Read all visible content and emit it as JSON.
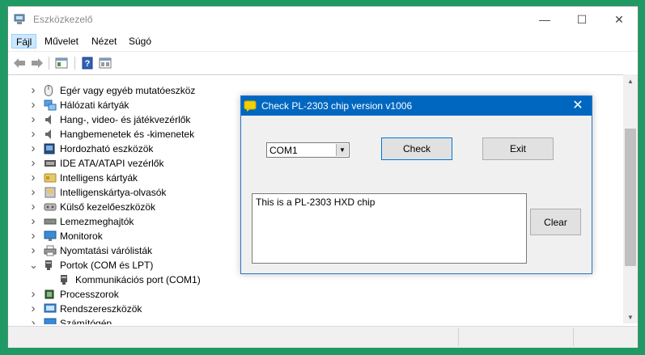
{
  "window": {
    "title": "Eszközkezelő",
    "controls": {
      "minimize": "—",
      "maximize": "☐",
      "close": "✕"
    }
  },
  "menu": {
    "items": [
      "Fájl",
      "Művelet",
      "Nézet",
      "Súgó"
    ]
  },
  "toolbar": {
    "icons": [
      "back-arrow-icon",
      "forward-arrow-icon",
      "properties-icon",
      "help-icon",
      "show-hidden-icon"
    ]
  },
  "tree": {
    "items": [
      {
        "label": "Egér vagy egyéb mutatóeszköz",
        "icon": "mouse-icon",
        "expanded": false,
        "level": 0
      },
      {
        "label": "Hálózati kártyák",
        "icon": "network-icon",
        "expanded": false,
        "level": 0
      },
      {
        "label": "Hang-, video- és játékvezérlők",
        "icon": "speaker-icon",
        "expanded": false,
        "level": 0
      },
      {
        "label": "Hangbemenetek és -kimenetek",
        "icon": "speaker-icon",
        "expanded": false,
        "level": 0
      },
      {
        "label": "Hordozható eszközök",
        "icon": "portable-device-icon",
        "expanded": false,
        "level": 0
      },
      {
        "label": "IDE ATA/ATAPI vezérlők",
        "icon": "ide-controller-icon",
        "expanded": false,
        "level": 0
      },
      {
        "label": "Intelligens kártyák",
        "icon": "smart-card-icon",
        "expanded": false,
        "level": 0
      },
      {
        "label": "Intelligenskártya-olvasók",
        "icon": "card-reader-icon",
        "expanded": false,
        "level": 0
      },
      {
        "label": "Külső kezelőeszközök",
        "icon": "hid-icon",
        "expanded": false,
        "level": 0
      },
      {
        "label": "Lemezmeghajtók",
        "icon": "disk-drive-icon",
        "expanded": false,
        "level": 0
      },
      {
        "label": "Monitorok",
        "icon": "monitor-icon",
        "expanded": false,
        "level": 0
      },
      {
        "label": "Nyomtatási várólisták",
        "icon": "printer-icon",
        "expanded": false,
        "level": 0
      },
      {
        "label": "Portok (COM és LPT)",
        "icon": "port-icon",
        "expanded": true,
        "level": 0
      },
      {
        "label": "Kommunikációs port (COM1)",
        "icon": "port-icon",
        "expanded": null,
        "level": 1
      },
      {
        "label": "Processzorok",
        "icon": "processor-icon",
        "expanded": false,
        "level": 0
      },
      {
        "label": "Rendszereszközök",
        "icon": "system-device-icon",
        "expanded": false,
        "level": 0
      },
      {
        "label": "Számítógép",
        "icon": "computer-icon",
        "expanded": false,
        "level": 0
      }
    ]
  },
  "dialog": {
    "title": "Check PL-2303 chip version v1006",
    "port_select": {
      "value": "COM1"
    },
    "check_label": "Check",
    "exit_label": "Exit",
    "clear_label": "Clear",
    "output": "This is a PL-2303 HXD chip",
    "close": "✕"
  },
  "colors": {
    "desktop": "#1f9a64",
    "dialog_titlebar": "#0067c0",
    "menu_highlight": "#cce8ff"
  }
}
